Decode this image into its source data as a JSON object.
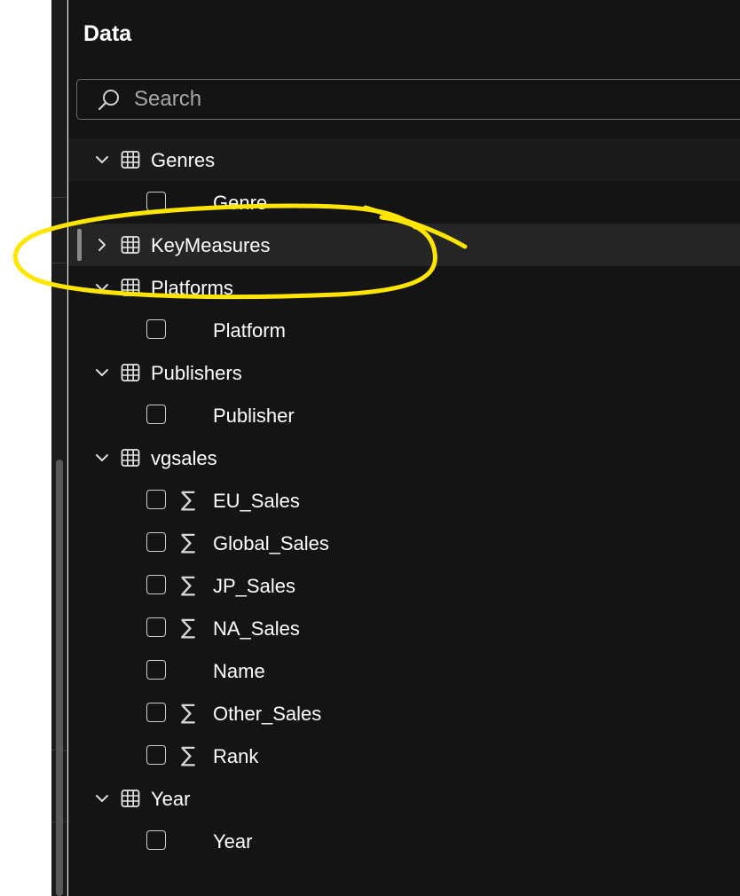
{
  "panel": {
    "title": "Data"
  },
  "search": {
    "placeholder": "Search",
    "value": ""
  },
  "tree": [
    {
      "table": "Genres",
      "expanded": true,
      "fields": [
        {
          "name": "Genre",
          "measure": false,
          "checked": false
        }
      ]
    },
    {
      "table": "KeyMeasures",
      "expanded": false,
      "selected": true,
      "fields": []
    },
    {
      "table": "Platforms",
      "expanded": true,
      "fields": [
        {
          "name": "Platform",
          "measure": false,
          "checked": false
        }
      ]
    },
    {
      "table": "Publishers",
      "expanded": true,
      "fields": [
        {
          "name": "Publisher",
          "measure": false,
          "checked": false
        }
      ]
    },
    {
      "table": "vgsales",
      "expanded": true,
      "fields": [
        {
          "name": "EU_Sales",
          "measure": true,
          "checked": false
        },
        {
          "name": "Global_Sales",
          "measure": true,
          "checked": false
        },
        {
          "name": "JP_Sales",
          "measure": true,
          "checked": false
        },
        {
          "name": "NA_Sales",
          "measure": true,
          "checked": false
        },
        {
          "name": "Name",
          "measure": false,
          "checked": false
        },
        {
          "name": "Other_Sales",
          "measure": true,
          "checked": false
        },
        {
          "name": "Rank",
          "measure": true,
          "checked": false
        }
      ]
    },
    {
      "table": "Year",
      "expanded": true,
      "fields": [
        {
          "name": "Year",
          "measure": false,
          "checked": false
        }
      ]
    }
  ],
  "icons": {
    "search": "search-icon",
    "expanded": "chevron-down-icon",
    "collapsed": "chevron-right-icon",
    "table": "table-icon",
    "measure": "sigma-icon"
  },
  "sigma_glyph": "∑",
  "colors": {
    "panel_background": "#141414",
    "selected_row": "#252525",
    "annotation": "#ffe600"
  }
}
